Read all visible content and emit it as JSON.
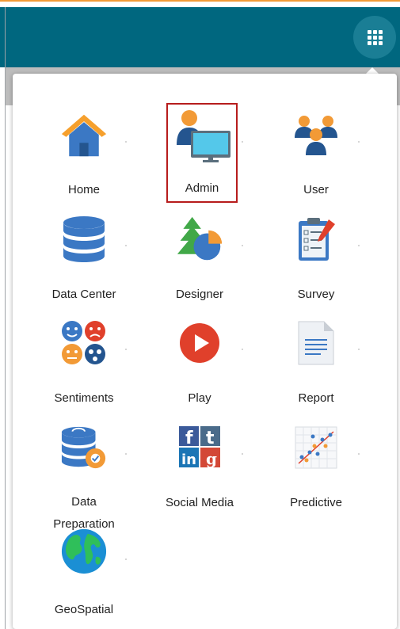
{
  "header": {
    "apps_button_icon": "grid-apps-icon",
    "colors": {
      "bar": "#00677f",
      "accent": "#f29a36",
      "selected_border": "#b71c1c"
    }
  },
  "apps": [
    {
      "label": "Home",
      "icon": "home-icon"
    },
    {
      "label": "Admin",
      "icon": "admin-icon",
      "selected": true
    },
    {
      "label": "User",
      "icon": "users-icon"
    },
    {
      "label": "Data Center",
      "icon": "database-icon"
    },
    {
      "label": "Designer",
      "icon": "designer-icon"
    },
    {
      "label": "Survey",
      "icon": "survey-clipboard-icon"
    },
    {
      "label": "Sentiments",
      "icon": "sentiments-faces-icon"
    },
    {
      "label": "Play",
      "icon": "play-icon"
    },
    {
      "label": "Report",
      "icon": "report-document-icon"
    },
    {
      "label": "Data Preparation",
      "label_lines": [
        "Data",
        "Preparation"
      ],
      "icon": "data-preparation-icon"
    },
    {
      "label": "Social Media",
      "icon": "social-media-icon"
    },
    {
      "label": "Predictive",
      "icon": "predictive-scatter-icon"
    },
    {
      "label": "GeoSpatial",
      "icon": "globe-icon"
    }
  ]
}
